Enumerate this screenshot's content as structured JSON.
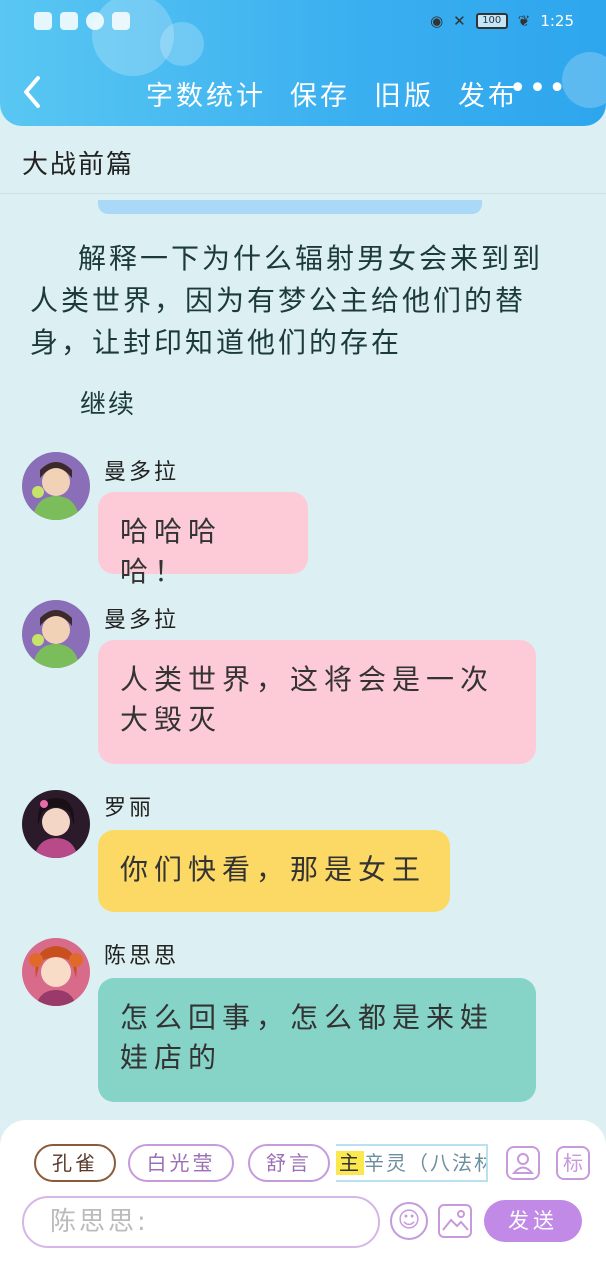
{
  "status_bar": {
    "battery": "100",
    "time": "1:25"
  },
  "header": {
    "back_icon": "chevron-left-icon",
    "nav": [
      "字数统计",
      "保存",
      "旧版",
      "发布"
    ],
    "more_icon": "more-icon"
  },
  "document": {
    "title": "大战前篇"
  },
  "narration": "解释一下为什么辐射男女会来到到人类世界，因为有梦公主给他们的替身，让封印知道他们的存在",
  "continue_label": "继续",
  "messages": [
    {
      "name": "曼多拉",
      "text": "哈哈哈哈！",
      "color": "#fdcbd8"
    },
    {
      "name": "曼多拉",
      "text": "人类世界，这将会是一次大毁灭",
      "color": "#fdcbd8"
    },
    {
      "name": "罗丽",
      "text": "你们快看，那是女王",
      "color": "#fcd965"
    },
    {
      "name": "陈思思",
      "text": "怎么回事，怎么都是来娃娃店的",
      "color": "#86d3c7"
    }
  ],
  "input_panel": {
    "chips": [
      "孔雀",
      "白光莹",
      "舒言"
    ],
    "highlight_chip": {
      "prefix": "主",
      "rest": "辛灵（八法林"
    },
    "mark_label": "标",
    "input_value": "陈思思:",
    "send_label": "发送"
  }
}
